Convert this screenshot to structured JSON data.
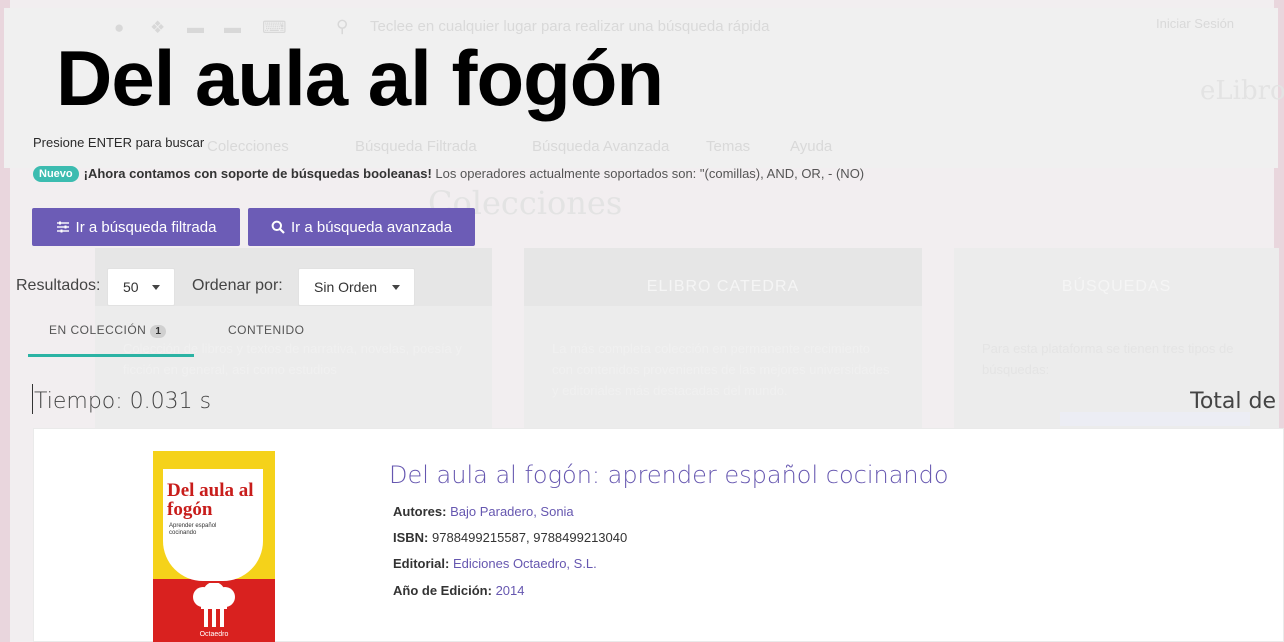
{
  "overlay": {
    "title": "Del aula al fogón",
    "search_hint": "Presione ENTER para buscar"
  },
  "ghost": {
    "search_placeholder": "Teclee en cualquier lugar para realizar una búsqueda rápida",
    "login": "Iniciar Sesión",
    "logo": "eLibro",
    "nav": [
      "Colecciones",
      "Búsqueda Filtrada",
      "Búsqueda Avanzada",
      "Temas",
      "Ayuda"
    ],
    "section_title": "Colecciones",
    "cards": [
      {
        "header": "",
        "desc": "Colección de libros y textos de narrativa, novelas, poesía y ficción en general, así como estudios"
      },
      {
        "header": "ELIBRO CATEDRA",
        "desc": "La más completa colección en permanente crecimiento con contenidos provenientes de las mejores universidades y editoriales más destacadas del mundo."
      },
      {
        "header": "BÚSQUEDAS",
        "desc": "Para esta plataforma se tienen tres tipos de búsquedas:"
      }
    ]
  },
  "notice": {
    "badge": "Nuevo",
    "headline": "¡Ahora contamos con soporte de búsquedas booleanas!",
    "text": " Los operadores actualmente soportados son: \"(comillas), AND, OR, - (NO)"
  },
  "buttons": {
    "filtered": "Ir a búsqueda filtrada",
    "advanced": "Ir a búsqueda avanzada"
  },
  "controls": {
    "results_label": "Resultados:",
    "results_value": "50",
    "sort_label": "Ordenar por:",
    "sort_value": "Sin Orden"
  },
  "tabs": [
    {
      "label": "EN COLECCIÓN",
      "count": "1",
      "active": true
    },
    {
      "label": "CONTENIDO",
      "active": false
    }
  ],
  "stats": {
    "time": "Tiempo: 0.031 s",
    "total": "Total de"
  },
  "result": {
    "title": "Del aula al fogón: aprender español cocinando",
    "authors_label": "Autores:",
    "authors": "Bajo Paradero, Sonia",
    "isbn_label": "ISBN:",
    "isbn": "9788499215587, 9788499213040",
    "publisher_label": "Editorial:",
    "publisher": "Ediciones Octaedro, S.L.",
    "year_label": "Año de Edición:",
    "year": "2014",
    "cover": {
      "title": "Del aula al fogón",
      "subtitle": "Aprender español cocinando",
      "publisher": "Octaedro"
    }
  },
  "colors": {
    "accent": "#6c5cb6",
    "link": "#6657b0",
    "teal": "#2bb3a4",
    "badge": "#3cbcb0"
  }
}
